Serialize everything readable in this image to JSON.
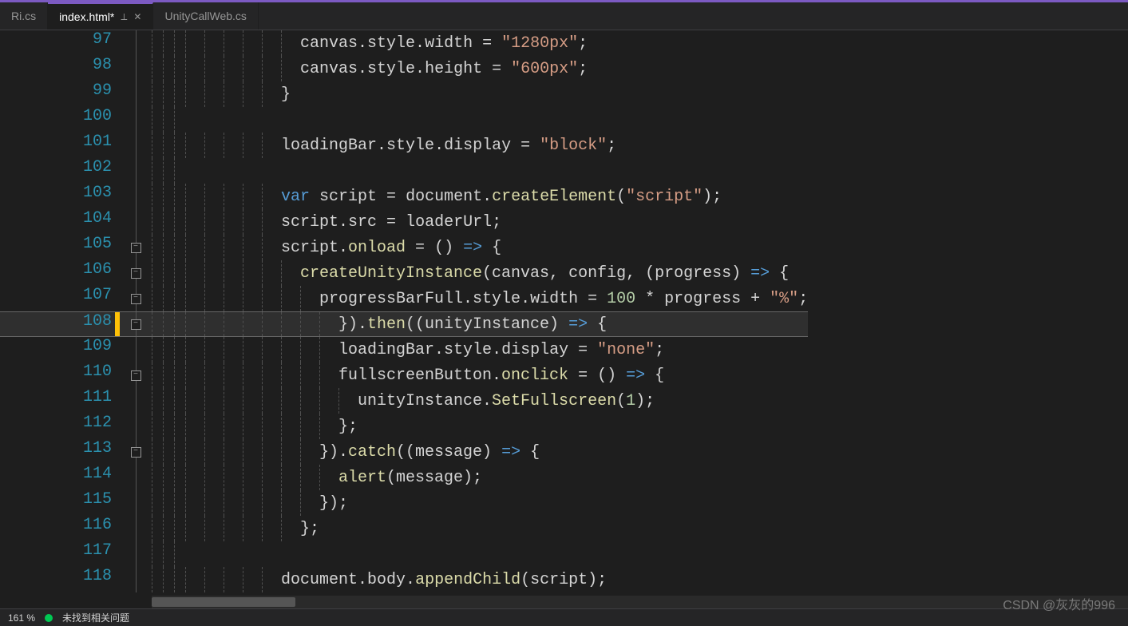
{
  "tabs": [
    {
      "label": "Ri.cs",
      "active": false
    },
    {
      "label": "index.html*",
      "active": true,
      "pinned": true,
      "closable": true
    },
    {
      "label": "UnityCallWeb.cs",
      "active": false
    }
  ],
  "status": {
    "zoom": "161 %",
    "issues": "未找到相关问题"
  },
  "watermark": "CSDN @灰灰的996",
  "lines": [
    {
      "n": 97,
      "indent": 6,
      "tokens": [
        [
          "i",
          "canvas"
        ],
        [
          "p",
          "."
        ],
        [
          "i",
          "style"
        ],
        [
          "p",
          "."
        ],
        [
          "i",
          "width"
        ],
        [
          "o",
          " = "
        ],
        [
          "s",
          "\"1280px\""
        ],
        [
          "p",
          ";"
        ]
      ]
    },
    {
      "n": 98,
      "indent": 6,
      "tokens": [
        [
          "i",
          "canvas"
        ],
        [
          "p",
          "."
        ],
        [
          "i",
          "style"
        ],
        [
          "p",
          "."
        ],
        [
          "i",
          "height"
        ],
        [
          "o",
          " = "
        ],
        [
          "s",
          "\"600px\""
        ],
        [
          "p",
          ";"
        ]
      ]
    },
    {
      "n": 99,
      "indent": 5,
      "tokens": [
        [
          "p",
          "}"
        ]
      ]
    },
    {
      "n": 100,
      "indent": 0,
      "tokens": []
    },
    {
      "n": 101,
      "indent": 5,
      "tokens": [
        [
          "i",
          "loadingBar"
        ],
        [
          "p",
          "."
        ],
        [
          "i",
          "style"
        ],
        [
          "p",
          "."
        ],
        [
          "i",
          "display"
        ],
        [
          "o",
          " = "
        ],
        [
          "s",
          "\"block\""
        ],
        [
          "p",
          ";"
        ]
      ]
    },
    {
      "n": 102,
      "indent": 0,
      "tokens": []
    },
    {
      "n": 103,
      "indent": 5,
      "tokens": [
        [
          "k",
          "var"
        ],
        [
          "p",
          " "
        ],
        [
          "i",
          "script"
        ],
        [
          "o",
          " = "
        ],
        [
          "i",
          "document"
        ],
        [
          "p",
          "."
        ],
        [
          "m",
          "createElement"
        ],
        [
          "p",
          "("
        ],
        [
          "s",
          "\"script\""
        ],
        [
          "p",
          ");"
        ]
      ]
    },
    {
      "n": 104,
      "indent": 5,
      "tokens": [
        [
          "i",
          "script"
        ],
        [
          "p",
          "."
        ],
        [
          "i",
          "src"
        ],
        [
          "o",
          " = "
        ],
        [
          "i",
          "loaderUrl"
        ],
        [
          "p",
          ";"
        ]
      ]
    },
    {
      "n": 105,
      "indent": 5,
      "fold": true,
      "tokens": [
        [
          "i",
          "script"
        ],
        [
          "p",
          "."
        ],
        [
          "m",
          "onload"
        ],
        [
          "o",
          " = "
        ],
        [
          "p",
          "() "
        ],
        [
          "k",
          "=>"
        ],
        [
          "p",
          " {"
        ]
      ]
    },
    {
      "n": 106,
      "indent": 6,
      "fold": true,
      "tokens": [
        [
          "m",
          "createUnityInstance"
        ],
        [
          "p",
          "(canvas, config, (progress) "
        ],
        [
          "k",
          "=>"
        ],
        [
          "p",
          " {"
        ]
      ]
    },
    {
      "n": 107,
      "indent": 7,
      "fold": true,
      "tokens": [
        [
          "i",
          "progressBarFull"
        ],
        [
          "p",
          "."
        ],
        [
          "i",
          "style"
        ],
        [
          "p",
          "."
        ],
        [
          "i",
          "width"
        ],
        [
          "o",
          " = "
        ],
        [
          "n",
          "100"
        ],
        [
          "o",
          " * "
        ],
        [
          "i",
          "progress"
        ],
        [
          "o",
          " + "
        ],
        [
          "s",
          "\"%\""
        ],
        [
          "p",
          ";"
        ]
      ]
    },
    {
      "n": 108,
      "indent": 8,
      "fold": true,
      "highlight": true,
      "changed": true,
      "tokens": [
        [
          "p",
          "})."
        ],
        [
          "m",
          "then"
        ],
        [
          "p",
          "((unityInstance) "
        ],
        [
          "k",
          "=>"
        ],
        [
          "p",
          " {"
        ]
      ]
    },
    {
      "n": 109,
      "indent": 8,
      "tokens": [
        [
          "i",
          "loadingBar"
        ],
        [
          "p",
          "."
        ],
        [
          "i",
          "style"
        ],
        [
          "p",
          "."
        ],
        [
          "i",
          "display"
        ],
        [
          "o",
          " = "
        ],
        [
          "s",
          "\"none\""
        ],
        [
          "p",
          ";"
        ]
      ]
    },
    {
      "n": 110,
      "indent": 8,
      "fold": true,
      "tokens": [
        [
          "i",
          "fullscreenButton"
        ],
        [
          "p",
          "."
        ],
        [
          "m",
          "onclick"
        ],
        [
          "o",
          " = "
        ],
        [
          "p",
          "() "
        ],
        [
          "k",
          "=>"
        ],
        [
          "p",
          " {"
        ]
      ]
    },
    {
      "n": 111,
      "indent": 9,
      "tokens": [
        [
          "i",
          "unityInstance"
        ],
        [
          "p",
          "."
        ],
        [
          "m",
          "SetFullscreen"
        ],
        [
          "p",
          "("
        ],
        [
          "n",
          "1"
        ],
        [
          "p",
          ");"
        ]
      ]
    },
    {
      "n": 112,
      "indent": 8,
      "tokens": [
        [
          "p",
          "};"
        ]
      ]
    },
    {
      "n": 113,
      "indent": 7,
      "fold": true,
      "tokens": [
        [
          "p",
          "})."
        ],
        [
          "m",
          "catch"
        ],
        [
          "p",
          "((message) "
        ],
        [
          "k",
          "=>"
        ],
        [
          "p",
          " {"
        ]
      ]
    },
    {
      "n": 114,
      "indent": 8,
      "tokens": [
        [
          "m",
          "alert"
        ],
        [
          "p",
          "(message);"
        ]
      ]
    },
    {
      "n": 115,
      "indent": 7,
      "tokens": [
        [
          "p",
          "});"
        ]
      ]
    },
    {
      "n": 116,
      "indent": 6,
      "tokens": [
        [
          "p",
          "};"
        ]
      ]
    },
    {
      "n": 117,
      "indent": 0,
      "tokens": []
    },
    {
      "n": 118,
      "indent": 5,
      "tokens": [
        [
          "i",
          "document"
        ],
        [
          "p",
          "."
        ],
        [
          "i",
          "body"
        ],
        [
          "p",
          "."
        ],
        [
          "m",
          "appendChild"
        ],
        [
          "p",
          "(script);"
        ]
      ]
    }
  ]
}
